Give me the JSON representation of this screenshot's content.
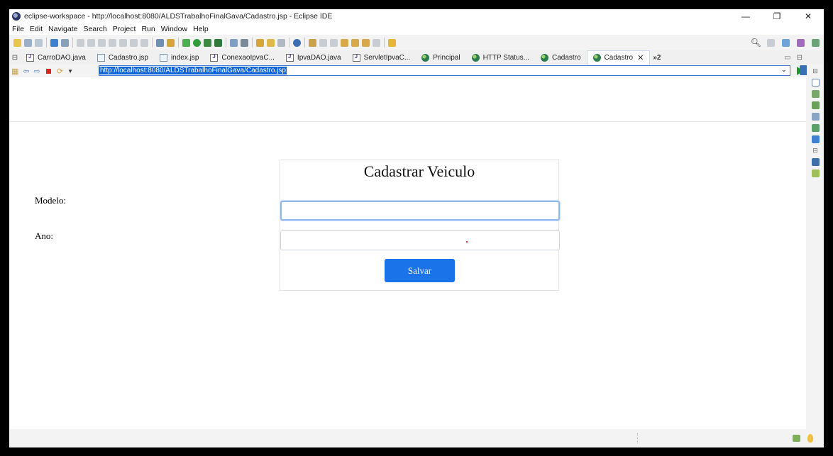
{
  "window": {
    "title": "eclipse-workspace - http://localhost:8080/ALDSTrabalhoFinalGava/Cadastro.jsp - Eclipse IDE",
    "controls": {
      "minimize": "—",
      "maximize": "❐",
      "close": "✕"
    }
  },
  "menu": [
    "File",
    "Edit",
    "Navigate",
    "Search",
    "Project",
    "Run",
    "Window",
    "Help"
  ],
  "tabs": [
    {
      "label": "CarroDAO.java",
      "icon": "java-file-icon"
    },
    {
      "label": "Cadastro.jsp",
      "icon": "jsp-file-icon"
    },
    {
      "label": "index.jsp",
      "icon": "jsp-file-icon"
    },
    {
      "label": "ConexaoIpvaC...",
      "icon": "java-file-icon"
    },
    {
      "label": "IpvaDAO.java",
      "icon": "java-file-icon"
    },
    {
      "label": "ServletIpvaC...",
      "icon": "java-file-icon"
    },
    {
      "label": "Principal",
      "icon": "globe-icon"
    },
    {
      "label": "HTTP Status...",
      "icon": "globe-icon"
    },
    {
      "label": "Cadastro",
      "icon": "globe-icon"
    },
    {
      "label": "Cadastro",
      "icon": "globe-icon",
      "active": true,
      "close": "✕"
    }
  ],
  "tabs_overflow": "»2",
  "address": {
    "url": "http://localhost:8080/ALDSTrabalhoFinalGava/Cadastro.jsp"
  },
  "page": {
    "title": "Cadastrar Veiculo",
    "modelo_label": "Modelo:",
    "ano_label": "Ano:",
    "modelo_value": "",
    "ano_value": "",
    "save_label": "Salvar"
  },
  "colors": {
    "accent": "#1a73e8",
    "url_highlight": "#0a64d8"
  }
}
